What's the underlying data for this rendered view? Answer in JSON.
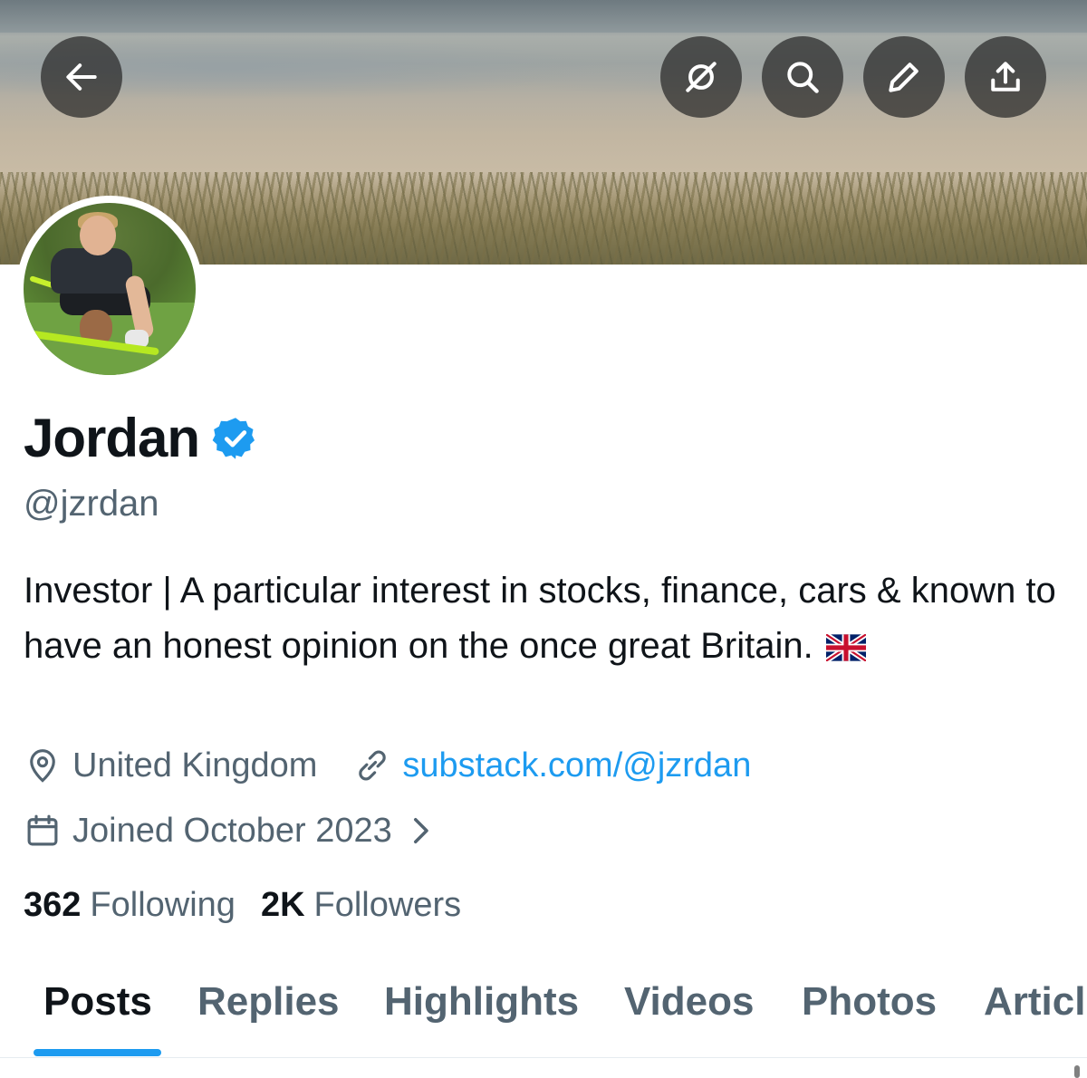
{
  "header": {
    "back_icon": "arrow-left-icon",
    "actions": [
      "hide-icon",
      "search-icon",
      "edit-icon",
      "share-icon"
    ]
  },
  "profile": {
    "name": "Jordan",
    "verified": true,
    "handle": "@jzrdan",
    "bio": "Investor | A particular interest in stocks, finance, cars & known to have an honest opinion on the once great Britain.",
    "bio_emoji": "flag-united-kingdom",
    "location": "United Kingdom",
    "website": "substack.com/@jzrdan",
    "joined": "Joined October 2023"
  },
  "stats": {
    "following_count": "362",
    "following_label": "Following",
    "followers_count": "2K",
    "followers_label": "Followers"
  },
  "tabs": [
    {
      "label": "Posts",
      "active": true
    },
    {
      "label": "Replies",
      "active": false
    },
    {
      "label": "Highlights",
      "active": false
    },
    {
      "label": "Videos",
      "active": false
    },
    {
      "label": "Photos",
      "active": false
    },
    {
      "label": "Articl",
      "active": false
    }
  ],
  "colors": {
    "accent": "#1d9bf0",
    "text_primary": "#0f1419",
    "text_secondary": "#536471"
  }
}
